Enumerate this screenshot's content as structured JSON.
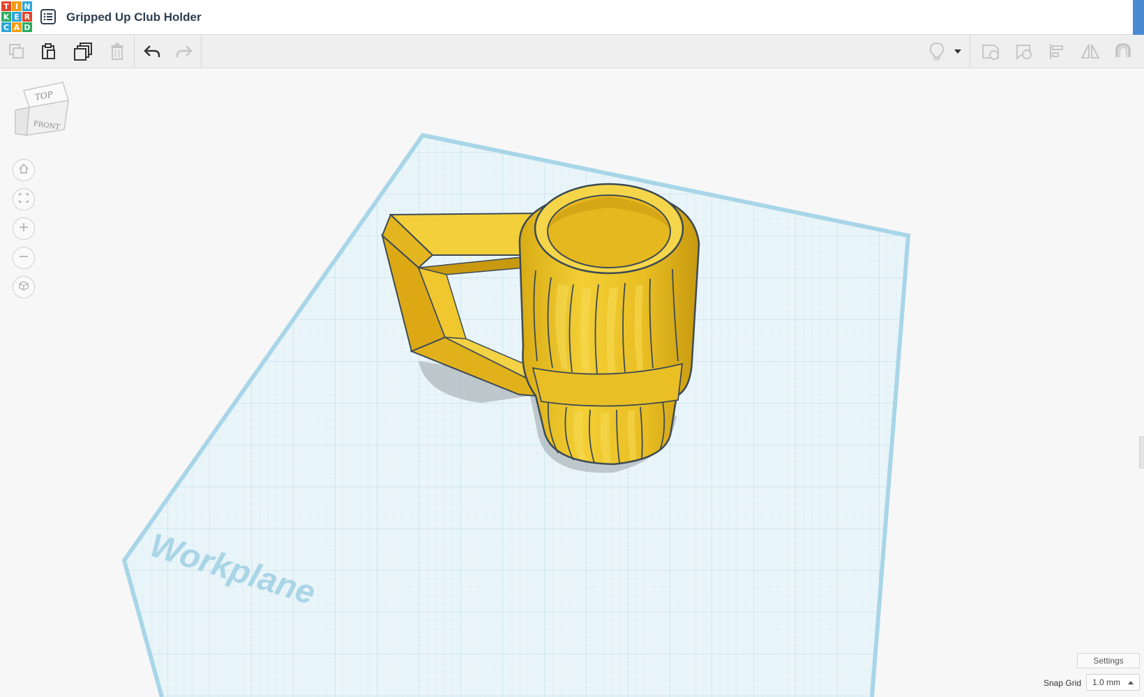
{
  "app": {
    "logo_letters": [
      "T",
      "I",
      "N",
      "K",
      "E",
      "R",
      "C",
      "A",
      "D"
    ],
    "logo_colors": [
      "#e2432a",
      "#f39c12",
      "#2ca6da",
      "#27ae60",
      "#2ca6da",
      "#e2432a",
      "#2ca6da",
      "#f39c12",
      "#27ae60"
    ],
    "design_title": "Gripped Up Club Holder"
  },
  "toolbar": {
    "buttons": [
      "copy-icon",
      "paste-icon",
      "duplicate-icon",
      "delete-icon",
      "undo-icon",
      "redo-icon",
      "lightbulb-icon",
      "dropdown-icon",
      "note-icon",
      "speech-bubble-icon",
      "align-icon",
      "mirror-icon",
      "magnet-icon"
    ]
  },
  "viewcube": {
    "top_label": "TOP",
    "front_label": "FRONT"
  },
  "nav": [
    "home-icon",
    "fit-icon",
    "zoom-in-icon",
    "zoom-out-icon",
    "ortho-icon"
  ],
  "workplane": {
    "label": "Workplane",
    "color": "#a8d6e8"
  },
  "model": {
    "color": "#f0c930"
  },
  "settings": {
    "label": "Settings"
  },
  "snap": {
    "label": "Snap Grid",
    "value": "1.0 mm"
  }
}
